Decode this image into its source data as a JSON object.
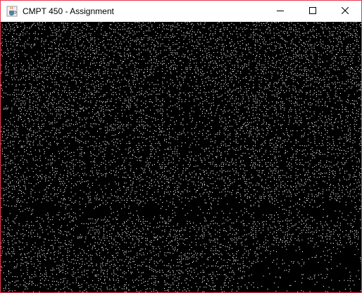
{
  "window": {
    "title": "CMPT 450 - Assignment",
    "icons": {
      "app": "java-coffee-cup-icon",
      "minimize": "minimize-icon",
      "maximize": "maximize-icon",
      "close": "close-icon"
    },
    "colors": {
      "border": "#e8384f",
      "titlebar": "#ffffff",
      "canvas_background": "#000000",
      "dot": "#ffffff"
    }
  },
  "canvas": {
    "content": "stippled-image",
    "icon": "dithered-photo"
  }
}
